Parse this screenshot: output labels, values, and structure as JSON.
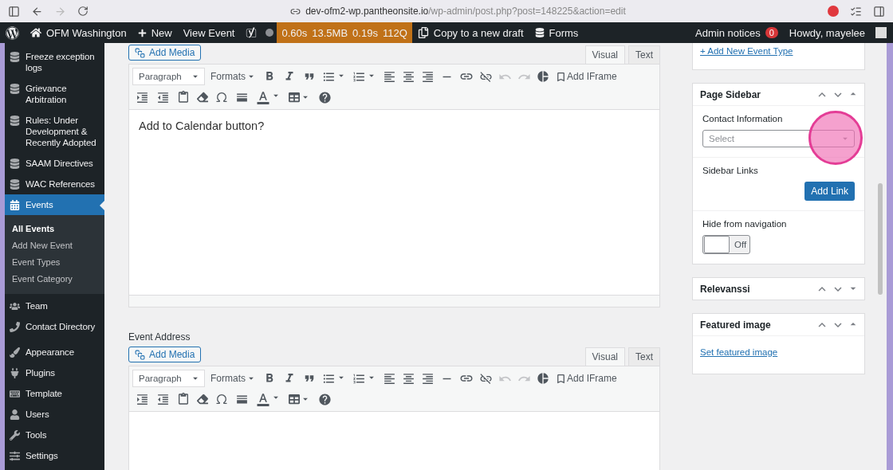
{
  "browser": {
    "host": "dev-ofm2-wp.pantheonsite.io",
    "path": "/wp-admin/post.php?post=148225&action=edit",
    "forward_disabled": true
  },
  "admin_bar": {
    "site": "OFM Washington",
    "new": "New",
    "view": "View Event",
    "perf": [
      "0.60s",
      "13.5MB",
      "0.19s",
      "112Q"
    ],
    "copy": "Copy to a new draft",
    "forms": "Forms",
    "notices": "Admin notices",
    "notice_count": "0",
    "howdy": "Howdy, mayelee"
  },
  "menu_groups": [
    [
      {
        "label": "Freeze exception logs",
        "selected": false
      },
      {
        "label": "Grievance Arbitration",
        "selected": false
      },
      {
        "label": "Rules: Under Development & Recently Adopted",
        "selected": false
      },
      {
        "label": "SAAM Directives",
        "selected": false
      },
      {
        "label": "WAC References",
        "selected": false
      },
      {
        "label": "Events",
        "selected": true,
        "children": [
          {
            "label": "All Events",
            "selected": true
          },
          {
            "label": "Add New Event",
            "selected": false
          },
          {
            "label": "Event Types",
            "selected": false
          },
          {
            "label": "Event Category",
            "selected": false
          }
        ]
      },
      {
        "label": "Team",
        "selected": false
      },
      {
        "label": "Contact Directory",
        "selected": false
      }
    ],
    [
      {
        "label": "Appearance",
        "selected": false
      },
      {
        "label": "Plugins",
        "selected": false
      },
      {
        "label": "Template",
        "selected": false
      },
      {
        "label": "Users",
        "selected": false
      },
      {
        "label": "Tools",
        "selected": false
      },
      {
        "label": "Settings",
        "selected": false
      }
    ]
  ],
  "editors": [
    {
      "add_media": "Add Media",
      "tabs": [
        {
          "label": "Visual",
          "selected": true
        },
        {
          "label": "Text",
          "selected": false
        }
      ],
      "toolbar": {
        "format": "Paragraph",
        "formats": "Formats",
        "iframe": "Add IFrame",
        "undo_disabled": true,
        "redo_disabled": true
      },
      "content": "Add to Calendar button?"
    },
    {
      "label": "Event Address",
      "add_media": "Add Media",
      "tabs": [
        {
          "label": "Visual",
          "selected": true
        },
        {
          "label": "Text",
          "selected": false
        }
      ],
      "toolbar": {
        "format": "Paragraph",
        "formats": "Formats",
        "iframe": "Add IFrame",
        "undo_disabled": true,
        "redo_disabled": true
      }
    }
  ],
  "side_boxes": [
    {
      "kind": "link-box",
      "link": "+ Add New Event Type"
    },
    {
      "kind": "panel",
      "title": "Page Sidebar",
      "expanded": true,
      "sections": [
        {
          "kind": "select",
          "label": "Contact Information",
          "placeholder": "Select"
        },
        {
          "kind": "button",
          "label": "Sidebar Links",
          "button": "Add Link"
        },
        {
          "kind": "toggle",
          "label": "Hide from navigation",
          "on": false,
          "state_text": "Off"
        }
      ]
    },
    {
      "kind": "panel",
      "title": "Relevanssi",
      "expanded": false
    },
    {
      "kind": "panel",
      "title": "Featured image",
      "expanded": true,
      "link": "Set featured image"
    }
  ],
  "click_marker": true
}
